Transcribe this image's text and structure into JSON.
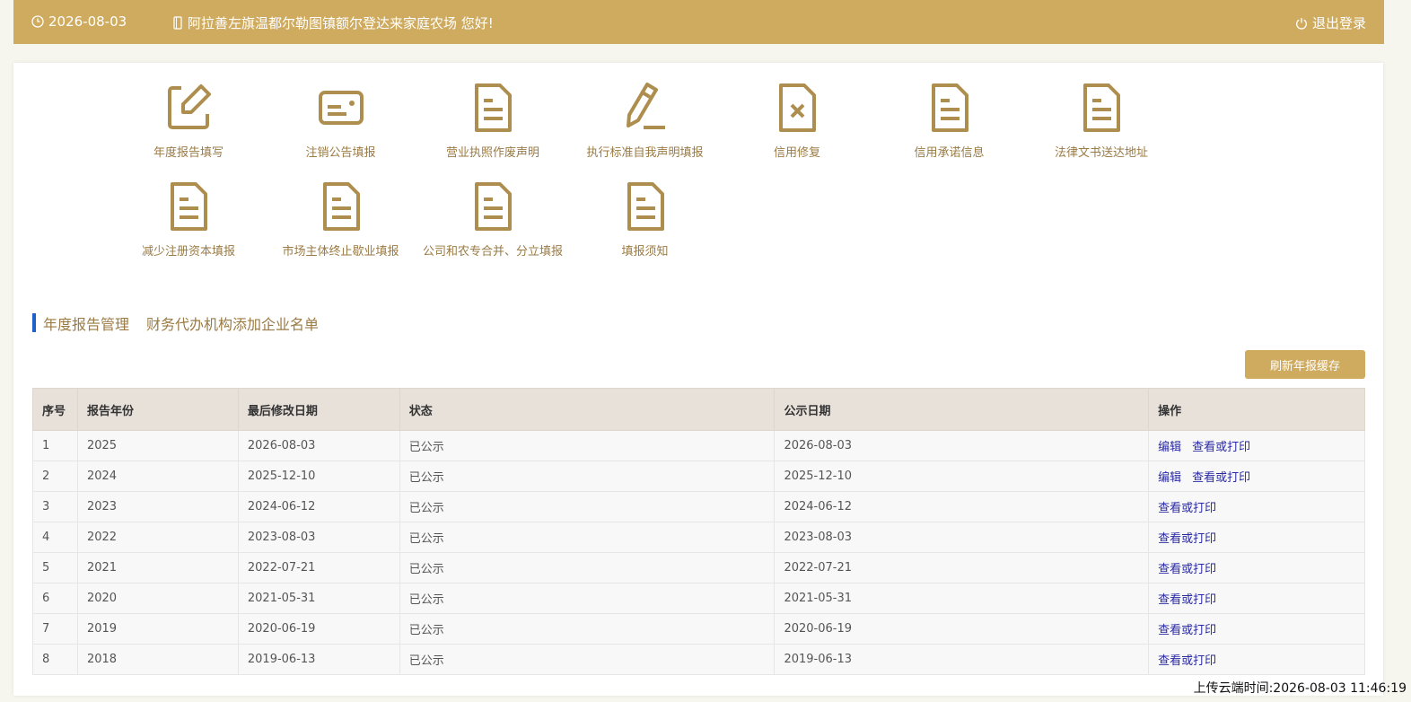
{
  "header": {
    "date": "2026-08-03",
    "greeting": "阿拉善左旗温都尔勒图镇额尔登达来家庭农场 您好!",
    "logout_label": "退出登录",
    "bg_color": "#cfab5f",
    "icons": [
      "clock-icon",
      "phone-icon",
      "power-icon"
    ]
  },
  "menu": {
    "items": [
      {
        "label": "年度报告填写",
        "icon": "edit-icon"
      },
      {
        "label": "注销公告填报",
        "icon": "card-icon"
      },
      {
        "label": "营业执照作废声明",
        "icon": "document-icon"
      },
      {
        "label": "执行标准自我声明填报",
        "icon": "pen-icon"
      },
      {
        "label": "信用修复",
        "icon": "document-x-icon"
      },
      {
        "label": "信用承诺信息",
        "icon": "document-icon"
      },
      {
        "label": "法律文书送达地址",
        "icon": "document-icon"
      },
      {
        "label": "减少注册资本填报",
        "icon": "document-icon"
      },
      {
        "label": "市场主体终止歇业填报",
        "icon": "document-icon"
      },
      {
        "label": "公司和农专合并、分立填报",
        "icon": "document-icon"
      },
      {
        "label": "填报须知",
        "icon": "document-icon"
      }
    ],
    "icon_color": "#ad8e4f"
  },
  "section": {
    "tab_active": "年度报告管理",
    "tab_other": "财务代办机构添加企业名单",
    "accent_color": "#1e62c9"
  },
  "toolbar": {
    "refresh_label": "刷新年报缓存"
  },
  "table": {
    "headers": [
      "序号",
      "报告年份",
      "最后修改日期",
      "状态",
      "公示日期",
      "操作"
    ],
    "rows": [
      {
        "no": "1",
        "year": "2025",
        "modified": "2026-08-03",
        "status": "已公示",
        "published": "2026-08-03",
        "actions": [
          "编辑",
          "查看或打印"
        ]
      },
      {
        "no": "2",
        "year": "2024",
        "modified": "2025-12-10",
        "status": "已公示",
        "published": "2025-12-10",
        "actions": [
          "编辑",
          "查看或打印"
        ]
      },
      {
        "no": "3",
        "year": "2023",
        "modified": "2024-06-12",
        "status": "已公示",
        "published": "2024-06-12",
        "actions": [
          "查看或打印"
        ]
      },
      {
        "no": "4",
        "year": "2022",
        "modified": "2023-08-03",
        "status": "已公示",
        "published": "2023-08-03",
        "actions": [
          "查看或打印"
        ]
      },
      {
        "no": "5",
        "year": "2021",
        "modified": "2022-07-21",
        "status": "已公示",
        "published": "2022-07-21",
        "actions": [
          "查看或打印"
        ]
      },
      {
        "no": "6",
        "year": "2020",
        "modified": "2021-05-31",
        "status": "已公示",
        "published": "2021-05-31",
        "actions": [
          "查看或打印"
        ]
      },
      {
        "no": "7",
        "year": "2019",
        "modified": "2020-06-19",
        "status": "已公示",
        "published": "2020-06-19",
        "actions": [
          "查看或打印"
        ]
      },
      {
        "no": "8",
        "year": "2018",
        "modified": "2019-06-13",
        "status": "已公示",
        "published": "2019-06-13",
        "actions": [
          "查看或打印"
        ]
      }
    ]
  },
  "footer": {
    "upload_time": "上传云端时间:2026-08-03 11:46:19"
  }
}
